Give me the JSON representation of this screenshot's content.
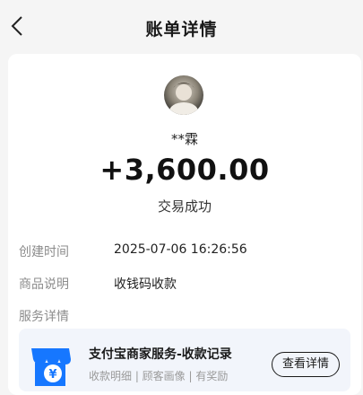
{
  "header": {
    "title": "账单详情",
    "back_icon": "chevron-left-icon"
  },
  "payer": {
    "name": "**霖",
    "avatar_icon": "user-avatar"
  },
  "transaction": {
    "amount": "+3,600.00",
    "status": "交易成功"
  },
  "details": [
    {
      "label": "创建时间",
      "value": "2025-07-06 16:26:56"
    },
    {
      "label": "商品说明",
      "value": "收钱码收款"
    },
    {
      "label": "服务详情",
      "value": ""
    }
  ],
  "service": {
    "icon": "merchant-store-icon",
    "title": "支付宝商家服务-收款记录",
    "subtitle": "收款明细 | 顾客画像 | 有奖励",
    "button_label": "查看详情",
    "accent": "#1677ff"
  }
}
